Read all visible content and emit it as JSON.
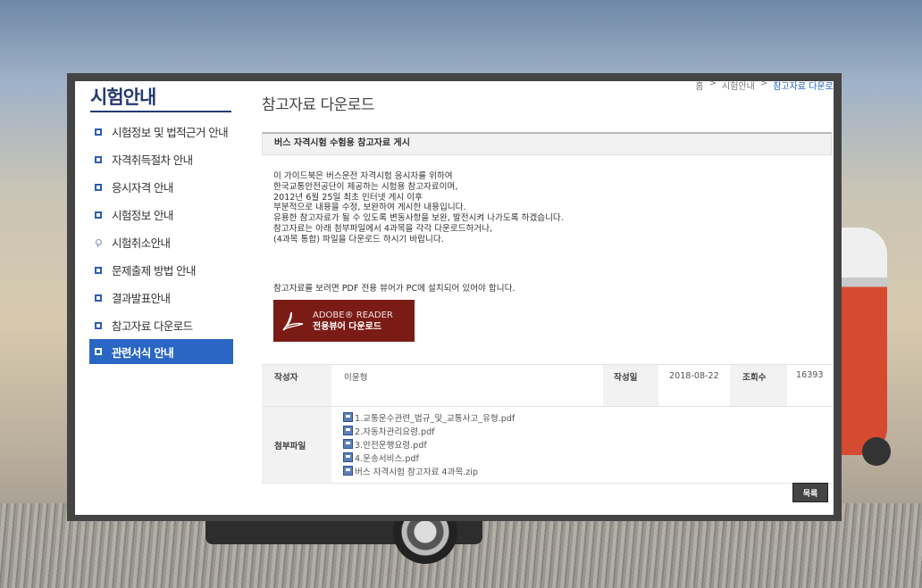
{
  "sidebar": {
    "title": "시험안내",
    "items": [
      {
        "label": "시험정보 및 법적근거 안내"
      },
      {
        "label": "자격취득절차 안내"
      },
      {
        "label": "응시자격 안내"
      },
      {
        "label": "시험정보 안내"
      },
      {
        "label": "시험취소안내"
      },
      {
        "label": "문제출제 방법 안내"
      },
      {
        "label": "결과발표안내"
      },
      {
        "label": "참고자료 다운로드"
      },
      {
        "label": "관련서식 안내"
      }
    ]
  },
  "page": {
    "title": "참고자료 다운로드",
    "breadcrumb": [
      "홈",
      ">",
      "시험안내",
      ">",
      "참고자료 다운로드"
    ]
  },
  "post": {
    "heading": "버스 자격시험 수험용 참고자료 게시",
    "lines": [
      "이 가이드북은 버스운전 자격시험 응시자를 위하여",
      "한국교통안전공단이 제공하는 시험용 참고자료이며,",
      "2012년 6월 25일 최초 인터넷 게시 이후",
      "부분적으로 내용을 수정, 보완하여 게시한 내용입니다.",
      "유용한 참고자료가 될 수 있도록 변동사항을 보완, 발전시켜 나가도록 하겠습니다.",
      "참고자료는 아래 첨부파일에서 4과목을 각각 다운로드하거나,",
      "(4과목 통합) 파일을 다운로드 하시기 바랍니다."
    ],
    "viewer_note": "참고자료를 보려면 PDF 전용 뷰어가 PC에 설치되어 있어야 합니다.",
    "adobe_line1": "ADOBE® READER",
    "adobe_line2": "전용뷰어 다운로드"
  },
  "info": {
    "author_label": "작성자",
    "author": "이윤형",
    "date_label": "작성일",
    "date": "2018-08-22",
    "views_label": "조회수",
    "views": "16393",
    "files_label": "첨부파일",
    "files": [
      "1.교통운수관련_법규_및_교통사고_유형.pdf",
      "2.자동차관리요령.pdf",
      "3.안전운행요령.pdf",
      "4.운송서비스.pdf",
      "버스 자격시험 참고자료 4과목.zip"
    ]
  },
  "buttons": {
    "list": "목록"
  },
  "colors": {
    "accent": "#2a67c4",
    "title_navy": "#243a72",
    "adobe_red": "#7a1b16"
  }
}
